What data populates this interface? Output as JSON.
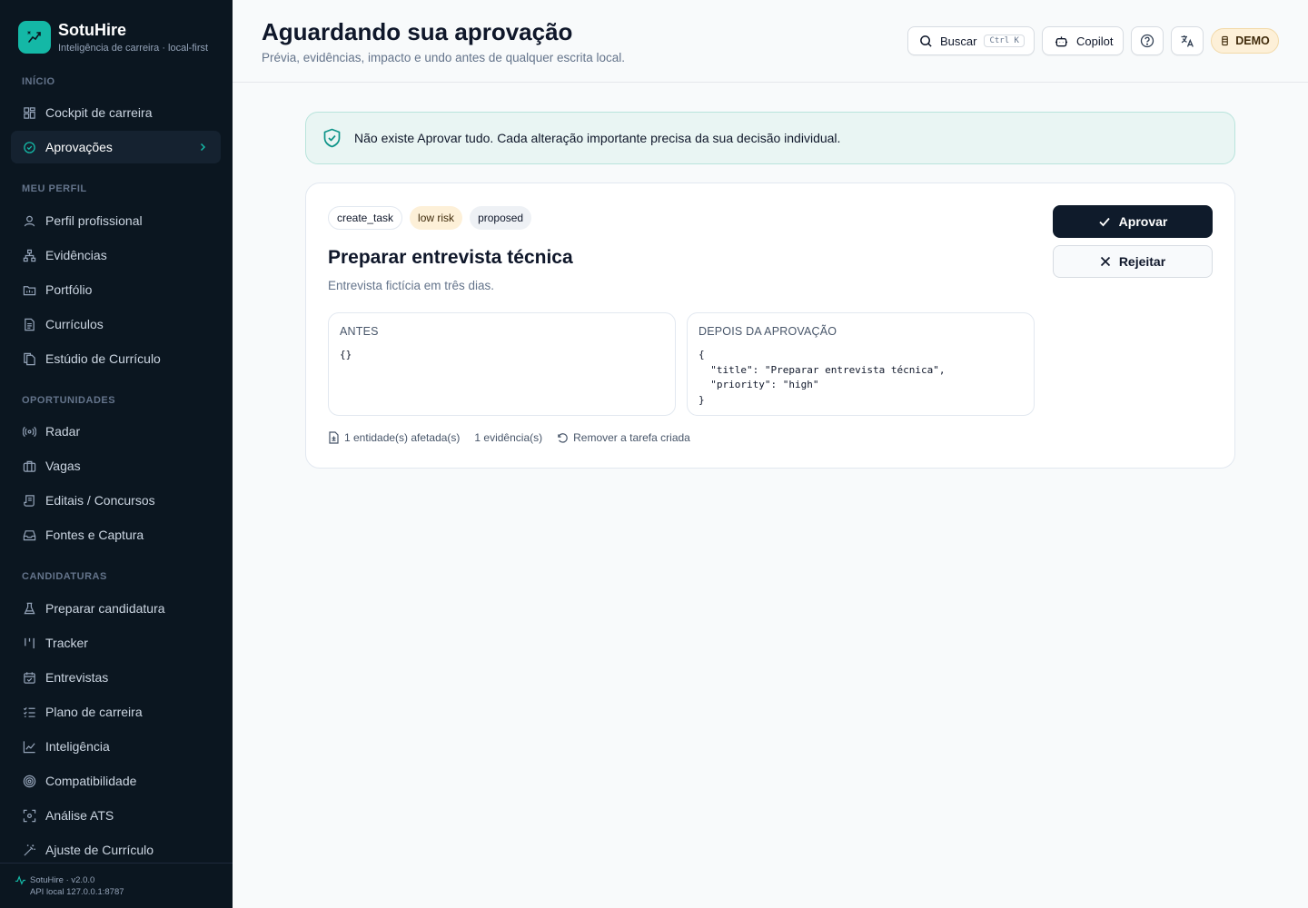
{
  "app": {
    "name": "SotuHire",
    "tagline": "Inteligência de carreira · local-first"
  },
  "sidebar": {
    "sections": [
      {
        "label": "INÍCIO"
      },
      {
        "label": "MEU PERFIL"
      },
      {
        "label": "OPORTUNIDADES"
      },
      {
        "label": "CANDIDATURAS"
      }
    ],
    "items": [
      {
        "label": "Cockpit de carreira",
        "icon": "dashboard-icon"
      },
      {
        "label": "Aprovações",
        "icon": "check-circle-icon",
        "active": true
      },
      {
        "label": "Perfil profissional",
        "icon": "user-icon"
      },
      {
        "label": "Evidências",
        "icon": "network-icon"
      },
      {
        "label": "Portfólio",
        "icon": "folder-icon"
      },
      {
        "label": "Currículos",
        "icon": "file-text-icon"
      },
      {
        "label": "Estúdio de Currículo",
        "icon": "copy-file-icon"
      },
      {
        "label": "Radar",
        "icon": "radar-icon"
      },
      {
        "label": "Vagas",
        "icon": "briefcase-icon"
      },
      {
        "label": "Editais / Concursos",
        "icon": "scroll-icon"
      },
      {
        "label": "Fontes e Captura",
        "icon": "inbox-icon"
      },
      {
        "label": "Preparar candidatura",
        "icon": "flask-icon"
      },
      {
        "label": "Tracker",
        "icon": "kanban-icon"
      },
      {
        "label": "Entrevistas",
        "icon": "calendar-check-icon"
      },
      {
        "label": "Plano de carreira",
        "icon": "list-checks-icon"
      },
      {
        "label": "Inteligência",
        "icon": "line-chart-icon"
      },
      {
        "label": "Compatibilidade",
        "icon": "target-icon"
      },
      {
        "label": "Análise ATS",
        "icon": "scan-icon"
      },
      {
        "label": "Ajuste de Currículo",
        "icon": "wand-icon"
      }
    ],
    "footer": {
      "version": "SotuHire · v2.0.0",
      "api": "API local 127.0.0.1:8787"
    }
  },
  "header": {
    "title": "Aguardando sua aprovação",
    "subtitle": "Prévia, evidências, impacto e undo antes de qualquer escrita local.",
    "search_label": "Buscar",
    "search_shortcut": "Ctrl K",
    "copilot_label": "Copilot",
    "demo_label": "DEMO"
  },
  "notice": {
    "text": "Não existe Aprovar tudo. Cada alteração importante precisa da sua decisão individual."
  },
  "approval": {
    "tags": {
      "operation": "create_task",
      "risk": "low risk",
      "status": "proposed"
    },
    "title": "Preparar entrevista técnica",
    "description": "Entrevista fictícia em três dias.",
    "before_label": "ANTES",
    "before_code": "{}",
    "after_label": "DEPOIS DA APROVAÇÃO",
    "after_code": "{\n  \"title\": \"Preparar entrevista técnica\",\n  \"priority\": \"high\"\n}",
    "meta": {
      "entities": "1 entidade(s) afetada(s)",
      "evidence": "1 evidência(s)",
      "undo": "Remover a tarefa criada"
    },
    "approve_label": "Aprovar",
    "reject_label": "Rejeitar"
  },
  "colors": {
    "accent": "#14b8a6",
    "sidebar_bg": "#0b1620",
    "primary_button": "#0f1b2b",
    "risk_badge": "#fdf0d8"
  }
}
